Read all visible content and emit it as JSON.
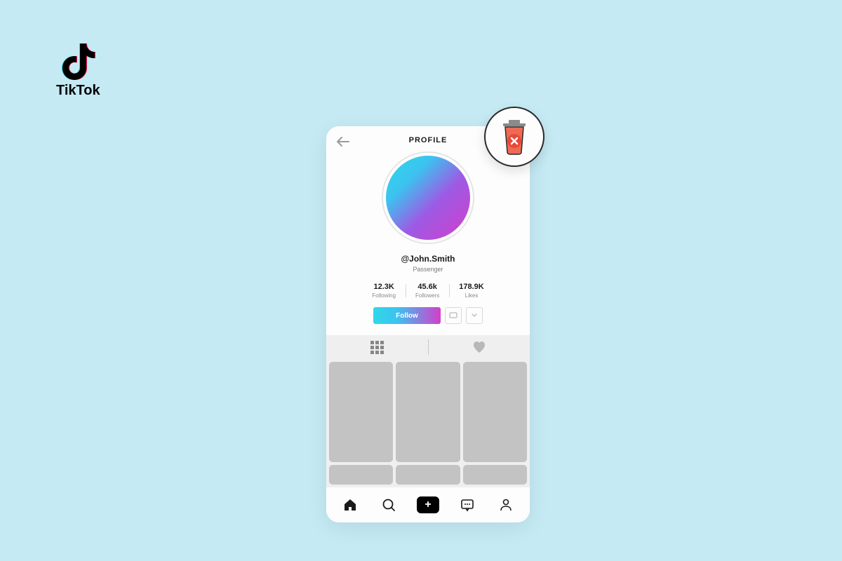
{
  "brand": {
    "name": "TikTok"
  },
  "header": {
    "title": "PROFILE"
  },
  "profile": {
    "username": "@John.Smith",
    "subtitle": "Passenger"
  },
  "stats": {
    "following": {
      "value": "12.3K",
      "label": "Following"
    },
    "followers": {
      "value": "45.6k",
      "label": "Followers"
    },
    "likes": {
      "value": "178.9K",
      "label": "Likes"
    }
  },
  "actions": {
    "follow_label": "Follow"
  },
  "nav": {
    "create_symbol": "+"
  }
}
